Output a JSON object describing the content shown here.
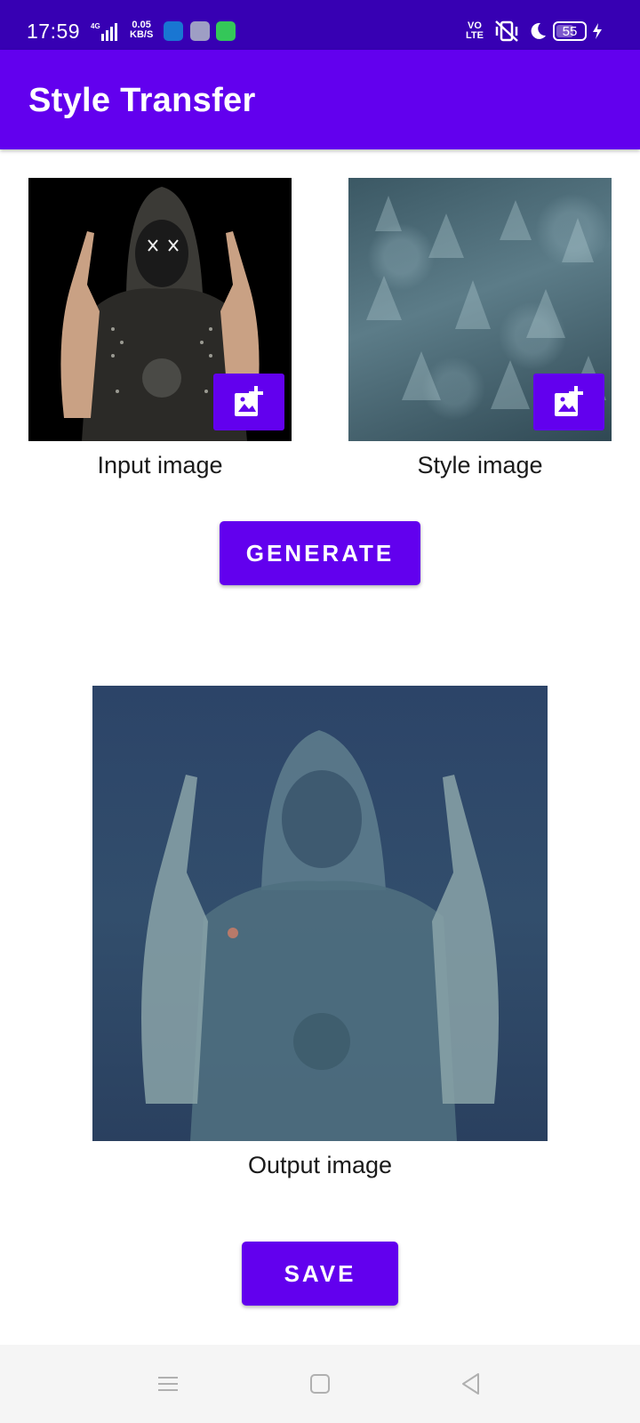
{
  "status_bar": {
    "time": "17:59",
    "network": "4G",
    "speed_value": "0.05",
    "speed_unit": "KB/S",
    "volte_top": "VO",
    "volte_bottom": "LTE",
    "battery": "55",
    "icons": [
      "signal-icon",
      "usb-app-icon",
      "store-app-icon",
      "chat-app-icon",
      "vibrate-off-icon",
      "do-not-disturb-moon-icon",
      "battery-icon",
      "charging-bolt-icon"
    ]
  },
  "app_bar": {
    "title": "Style Transfer"
  },
  "input_panel": {
    "caption": "Input image",
    "button_icon": "add-photo-icon"
  },
  "style_panel": {
    "caption": "Style image",
    "button_icon": "add-photo-icon"
  },
  "actions": {
    "generate_label": "GENERATE",
    "save_label": "SAVE"
  },
  "output_panel": {
    "caption": "Output image"
  },
  "nav_bar": {
    "icons": [
      "menu-icon",
      "home-square-icon",
      "back-triangle-icon"
    ]
  },
  "colors": {
    "status_bar": "#3700b3",
    "primary": "#6200ee",
    "nav_bar": "#f5f5f5"
  }
}
